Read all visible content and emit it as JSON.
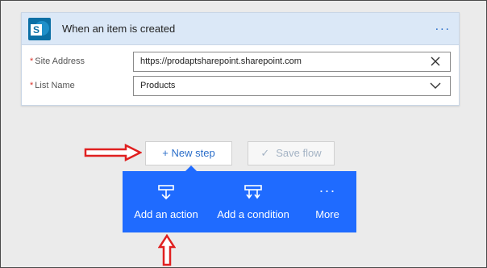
{
  "trigger": {
    "title": "When an item is created",
    "menu_glyph": "...",
    "icon_letter": "S",
    "fields": [
      {
        "required_mark": "*",
        "label": "Site Address",
        "value": "https://prodaptsharepoint.sharepoint.com"
      },
      {
        "required_mark": "*",
        "label": "List Name",
        "value": "Products"
      }
    ]
  },
  "toolbar": {
    "new_step_label": "+ New step",
    "save_flow_label": "Save flow",
    "save_flow_check": "✓"
  },
  "menu": {
    "items": [
      {
        "label": "Add an action",
        "icon": "action-icon"
      },
      {
        "label": "Add a condition",
        "icon": "condition-icon"
      },
      {
        "label": "More",
        "icon": "more-icon",
        "glyph": "···"
      }
    ]
  },
  "colors": {
    "accent": "#2b6ec9",
    "menu_bg": "#1f6bff",
    "header_bg": "#dbe8f7",
    "annotation": "#e02020"
  }
}
